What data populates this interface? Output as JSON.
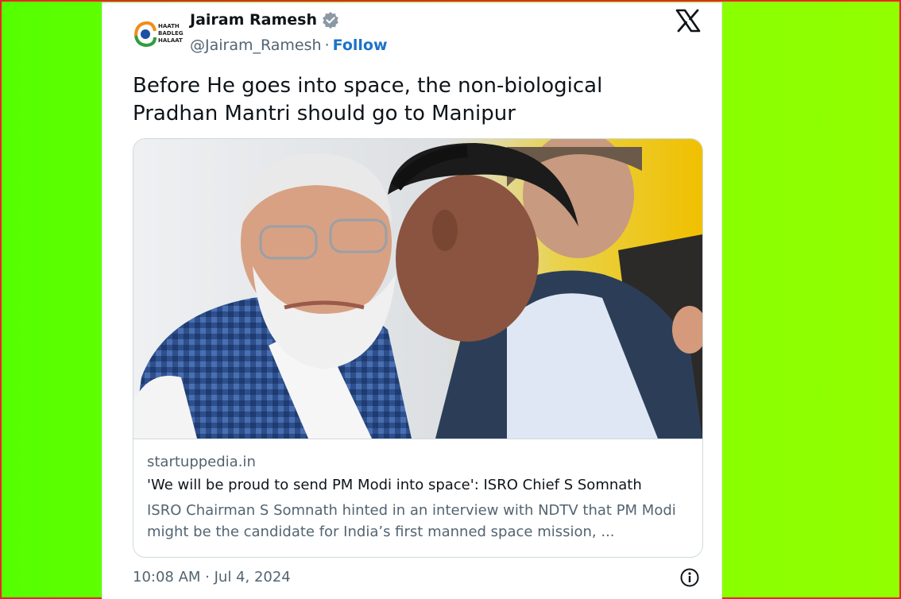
{
  "author": {
    "display_name": "Jairam Ramesh",
    "handle": "@Jairam_Ramesh",
    "separator": "·",
    "follow_label": "Follow",
    "avatar_text": [
      "HAATH",
      "BADLEGA",
      "HALAAT"
    ],
    "verified_icon": "verified-badge-icon"
  },
  "brand_icon": "x-logo-icon",
  "tweet": {
    "text": "Before He goes into space, the non-biological Pradhan Mantri should go to Manipur"
  },
  "link_card": {
    "domain": "startuppedia.in",
    "title": "'We will be proud to send PM Modi into space': ISRO Chief S Somnath",
    "description": "ISRO Chairman S Somnath hinted in an interview with NDTV that PM Modi might be the candidate for India’s first manned space mission, ..."
  },
  "footer": {
    "timestamp": "10:08 AM · Jul 4, 2024",
    "info_icon": "info-icon"
  },
  "colors": {
    "background_left": "#55ff00",
    "background_right": "#92ff00",
    "frame_border": "#e8262a",
    "follow_link": "#1d73c9",
    "secondary_text": "#536471"
  }
}
